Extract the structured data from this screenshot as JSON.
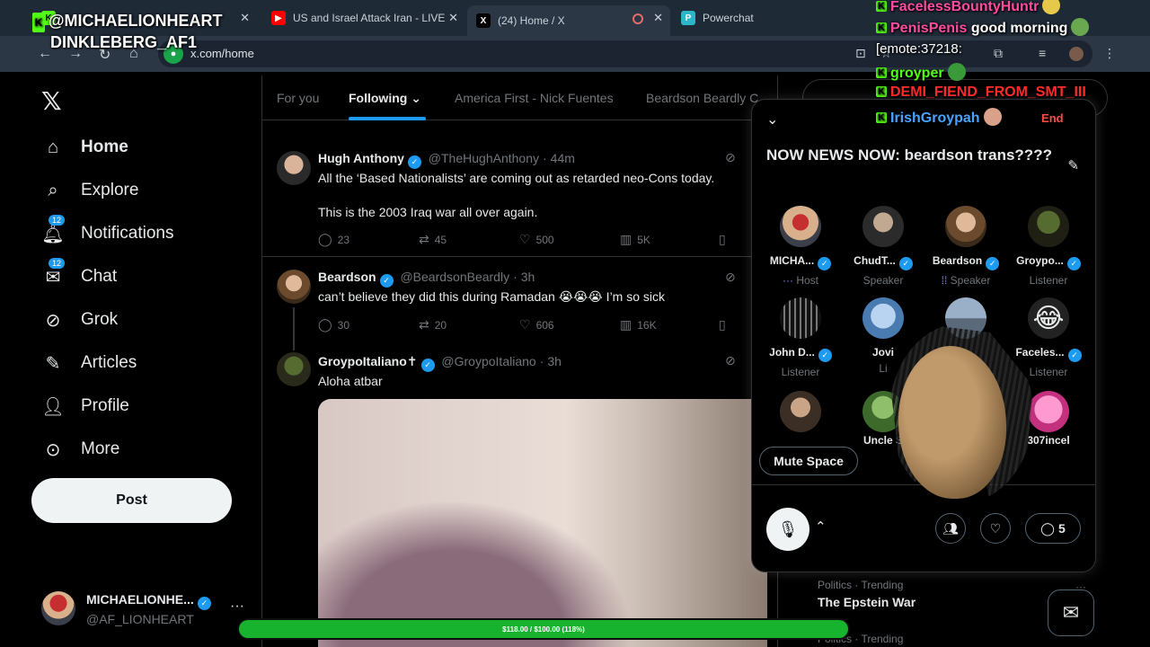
{
  "browser": {
    "tabs": [
      {
        "label": "",
        "favicon": "kick-icon"
      },
      {
        "label": "US and Israel Attack Iran - LIVE",
        "favicon": "youtube-icon"
      },
      {
        "label": "(24) Home / X",
        "favicon": "x-icon"
      },
      {
        "label": "Powerchat",
        "favicon": "powerchat-icon"
      }
    ],
    "url": "x.com/home"
  },
  "stream_overlay": {
    "title_line1": "@MICHAELIONHEART",
    "title_line2": "DINKLEBERG_AF1",
    "chat": [
      {
        "user": "FacelessBountyHuntr",
        "message": "",
        "color": "#ff4ba0"
      },
      {
        "user": "PenisPenis",
        "message": "good morning",
        "color": "#ff4ba0"
      },
      {
        "user": "",
        "message": "[emote:37218:",
        "color": "#ffffff"
      },
      {
        "user": "groyper",
        "message": "",
        "color": "#53fc18"
      },
      {
        "user": "DEMI_FIEND_FROM_SMT_III",
        "message": "",
        "color": "#ff2a2a"
      },
      {
        "user": "IrishGroypah",
        "message": "",
        "color": "#4aa3ff"
      }
    ],
    "goal_text": "$118.00 / $100.00 (118%)",
    "goal_fraction": 1.0
  },
  "nav": {
    "items": [
      {
        "label": "Home",
        "icon": "home-icon"
      },
      {
        "label": "Explore",
        "icon": "search-icon"
      },
      {
        "label": "Notifications",
        "icon": "bell-icon",
        "badge": "12"
      },
      {
        "label": "Chat",
        "icon": "mail-icon",
        "badge": "12"
      },
      {
        "label": "Grok",
        "icon": "grok-icon"
      },
      {
        "label": "Articles",
        "icon": "articles-icon"
      },
      {
        "label": "Profile",
        "icon": "person-icon"
      },
      {
        "label": "More",
        "icon": "more-circle-icon"
      }
    ],
    "post_label": "Post"
  },
  "account": {
    "name": "MICHAELIONHE...",
    "handle": "@AF_LIONHEART"
  },
  "feed": {
    "tabs": [
      "For you",
      "Following",
      "America First - Nick Fuentes",
      "Beardson Beardly C"
    ],
    "tweets": [
      {
        "name": "Hugh Anthony",
        "handle": "@TheHughAnthony",
        "time": "44m",
        "text1": "All the ‘Based Nationalists’ are coming out as retarded neo-Cons today.",
        "text2": "This is the 2003 Iraq war all over again.",
        "replies": "23",
        "reposts": "45",
        "likes": "500",
        "views": "5K"
      },
      {
        "name": "Beardson",
        "handle": "@BeardsonBeardly",
        "time": "3h",
        "text1": "can’t believe they did this during Ramadan 😭😭😭 I’m so sick",
        "replies": "30",
        "reposts": "20",
        "likes": "606",
        "views": "16K"
      },
      {
        "name": "GroypoItaliano✝",
        "handle": "@GroypoItaliano",
        "time": "3h",
        "text1": "Aloha atbar"
      }
    ]
  },
  "trends": [
    {
      "category": "Politics · Trending",
      "title": "The Epstein War"
    },
    {
      "category": "Politics · Trending",
      "title": ""
    }
  ],
  "space": {
    "title": "NOW NEWS NOW: beardson trans????",
    "participants": [
      {
        "name": "MICHA...",
        "role": "Host"
      },
      {
        "name": "ChudT...",
        "role": "Speaker"
      },
      {
        "name": "Beardson",
        "role": "Speaker"
      },
      {
        "name": "Groypo...",
        "role": "Listener"
      },
      {
        "name": "John D...",
        "role": "Listener"
      },
      {
        "name": "Jovi",
        "role": "Li"
      },
      {
        "name": "",
        "role": ""
      },
      {
        "name": "Faceles...",
        "role": "Listener"
      },
      {
        "name": "",
        "role": ""
      },
      {
        "name": "Uncle S",
        "role": ""
      },
      {
        "name": "",
        "role": ""
      },
      {
        "name": "307incel",
        "role": ""
      }
    ],
    "mute_label": "Mute Space",
    "comments_count": "5",
    "end_label": "End"
  }
}
